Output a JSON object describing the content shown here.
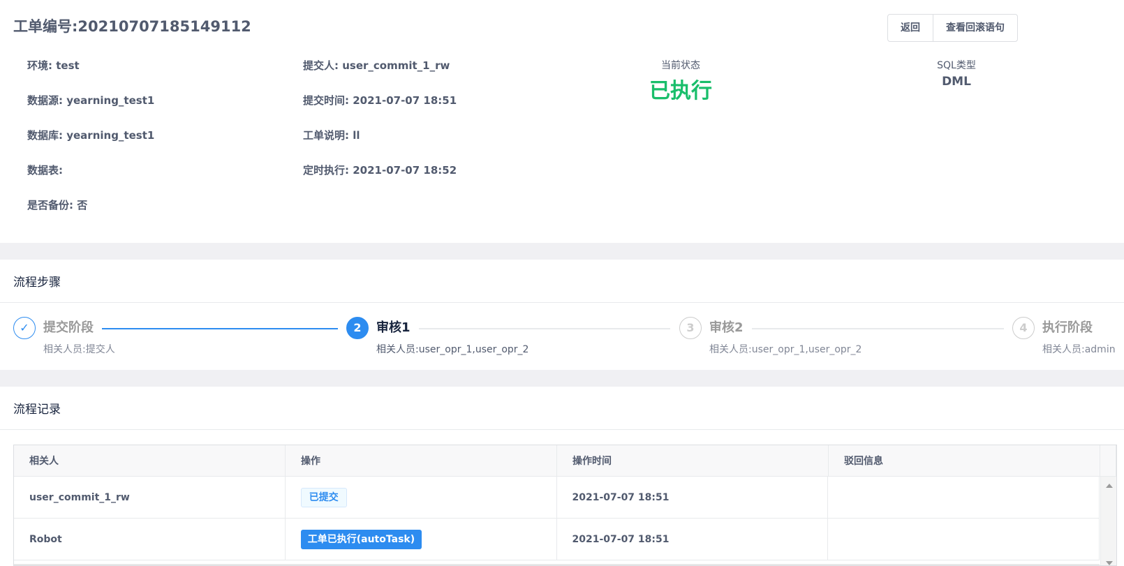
{
  "order": {
    "title": "工单编号:20210707185149112"
  },
  "actions": {
    "back_label": "返回",
    "rollback_label": "查看回滚语句"
  },
  "info": {
    "env": "环境: test",
    "datasource": "数据源: yearning_test1",
    "database": "数据库: yearning_test1",
    "table": "数据表:",
    "backup": "是否备份: 否",
    "submitter": "提交人: user_commit_1_rw",
    "submit_time": "提交时间: 2021-07-07 18:51",
    "description": "工单说明: ll",
    "scheduled": "定时执行: 2021-07-07 18:52"
  },
  "status": {
    "label": "当前状态",
    "value": "已执行",
    "color": "#19be6b"
  },
  "sql_type": {
    "label": "SQL类型",
    "value": "DML"
  },
  "steps_card": {
    "title": "流程步骤",
    "steps": [
      {
        "number": "✓",
        "title": "提交阶段",
        "desc": "相关人员:提交人",
        "state": "done"
      },
      {
        "number": "2",
        "title": "审核1",
        "desc": "相关人员:user_opr_1,user_opr_2",
        "state": "active"
      },
      {
        "number": "3",
        "title": "审核2",
        "desc": "相关人员:user_opr_1,user_opr_2",
        "state": "wait"
      },
      {
        "number": "4",
        "title": "执行阶段",
        "desc": "相关人员:admin",
        "state": "wait"
      }
    ]
  },
  "records_card": {
    "title": "流程记录",
    "columns": [
      "相关人",
      "操作",
      "操作时间",
      "驳回信息"
    ],
    "rows": [
      {
        "person": "user_commit_1_rw",
        "action": "已提交",
        "time": "2021-07-07 18:51",
        "reject": ""
      },
      {
        "person": "Robot",
        "action": "工单已执行(autoTask)",
        "time": "2021-07-07 18:51",
        "reject": ""
      }
    ]
  },
  "colors": {
    "primary": "#2d8cf0",
    "success": "#19be6b",
    "text": "#515a6e"
  }
}
